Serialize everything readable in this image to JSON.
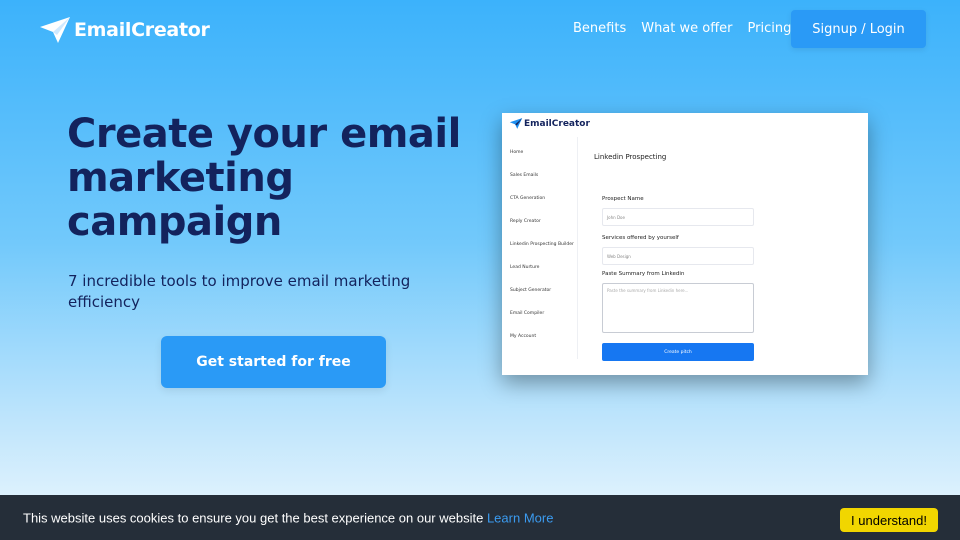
{
  "header": {
    "brand": "EmailCreator",
    "nav": [
      "Benefits",
      "What we offer",
      "Pricing"
    ],
    "signup_label": "Signup / Login"
  },
  "hero": {
    "title_lines": [
      "Create your email",
      "marketing",
      "campaign"
    ],
    "subtitle": "7 incredible tools to improve email marketing efficiency",
    "cta_label": "Get started for free"
  },
  "preview": {
    "brand": "EmailCreator",
    "sidebar": [
      "Home",
      "Sales Emails",
      "CTA Generation",
      "Reply Creator",
      "Linkedin Prospecting Builder",
      "Lead Nurture",
      "Subject Generator",
      "Email Compiler",
      "My Account"
    ],
    "page_title": "Linkedin Prospecting",
    "fields": [
      {
        "label": "Prospect Name",
        "placeholder": "John Doe"
      },
      {
        "label": "Services offered by yourself",
        "placeholder": "Web Design"
      }
    ],
    "textarea_label": "Paste Summary from Linkedin",
    "textarea_placeholder": "Paste the summary from Linkedin here...",
    "button_label": "Create pitch"
  },
  "cookie": {
    "message": "This website uses cookies to ensure you get the best experience on our website",
    "link_label": "Learn More",
    "accept_label": "I understand!"
  },
  "colors": {
    "brand_blue": "#2a9af6",
    "title_navy": "#13235d",
    "cookie_bg": "#252e39",
    "cookie_button": "#f1d600"
  }
}
